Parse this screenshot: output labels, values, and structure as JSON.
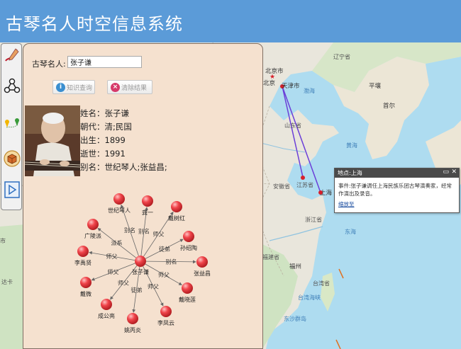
{
  "app": {
    "title": "古琴名人时空信息系统"
  },
  "toolbar": {
    "tools": [
      {
        "name": "draw-tool-icon"
      },
      {
        "name": "network-tool-icon"
      },
      {
        "name": "path-tool-icon"
      },
      {
        "name": "box-tool-icon"
      },
      {
        "name": "play-tool-icon"
      }
    ]
  },
  "search": {
    "label": "古琴名人:",
    "value": "张子谦",
    "query_button": "知识查询",
    "clear_button": "清除结果"
  },
  "person": {
    "lines": [
      "姓名：张子谦",
      "朝代：清;民国",
      "出生：1899",
      "逝世：1991",
      "别名：世纪琴人;张益昌;"
    ]
  },
  "graph": {
    "center": "张子谦",
    "nodes": [
      {
        "label": "世纪琴人",
        "edge": "别名"
      },
      {
        "label": "龚一",
        "edge": "别名"
      },
      {
        "label": "戴树红",
        "edge": "师父"
      },
      {
        "label": "广陵派",
        "edge": "派系"
      },
      {
        "label": "孙绍陶",
        "edge": "徒弟"
      },
      {
        "label": "李禹贤",
        "edge": "师父"
      },
      {
        "label": "张益昌",
        "edge": "别名"
      },
      {
        "label": "戴微",
        "edge": "师父"
      },
      {
        "label": "戴晓莲",
        "edge": "师父"
      },
      {
        "label": "成公亮",
        "edge": "师父"
      },
      {
        "label": "李凤云",
        "edge": "师父"
      },
      {
        "label": "姚丙炎",
        "edge": "徒弟"
      }
    ]
  },
  "map": {
    "labels": {
      "beijing_cn": "北京市",
      "beijing": "北京",
      "tianjin": "天津市",
      "liaoning": "辽宁省",
      "pingrang": "平壤",
      "korea": "首尔",
      "bohai": "渤海",
      "huanghai": "黄海",
      "shandong": "山东省",
      "jiangsu": "江苏省",
      "anhui": "安徽省",
      "shanghai": "上海",
      "zhejiang": "浙江省",
      "donghai": "东海",
      "taiwan": "台湾省",
      "fuzhou": "福州",
      "fujian": "福建省",
      "taiwan_strait": "台湾海峡",
      "donghai_gas": "东沙群岛",
      "henan_partial": "市",
      "jiangxi_partial": "达卡"
    }
  },
  "popup": {
    "title": "地点:上海",
    "event": "事件:张子谦调任上海民族乐团古琴演奏家，经常作演出及录音。",
    "link": "缩放至"
  }
}
